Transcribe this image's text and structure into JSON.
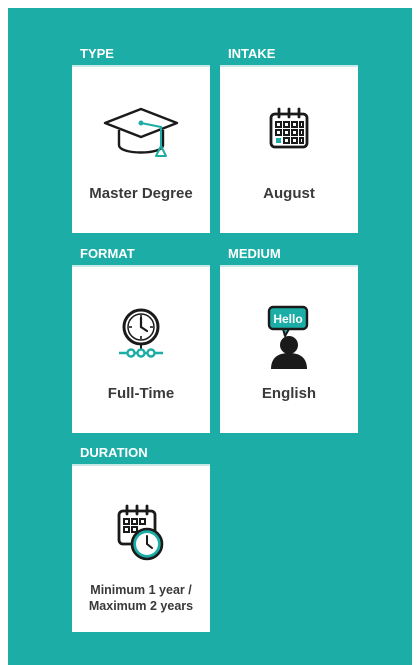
{
  "cards": [
    {
      "key": "type",
      "heading": "TYPE",
      "value": "Master Degree",
      "icon": "graduation-cap-icon"
    },
    {
      "key": "intake",
      "heading": "INTAKE",
      "value": "August",
      "icon": "calendar-icon"
    },
    {
      "key": "format",
      "heading": "FORMAT",
      "value": "Full-Time",
      "icon": "clock-icon"
    },
    {
      "key": "medium",
      "heading": "MEDIUM",
      "value": "English",
      "icon": "speech-bubble-person-icon",
      "bubble_text": "Hello"
    },
    {
      "key": "duration",
      "heading": "DURATION",
      "value_line1": "Minimum 1 year /",
      "value_line2": "Maximum 2 years",
      "icon": "calendar-clock-icon"
    }
  ],
  "colors": {
    "background": "#1cada6",
    "card": "#ffffff",
    "accent": "#1cada6",
    "text": "#3a3a3a"
  }
}
